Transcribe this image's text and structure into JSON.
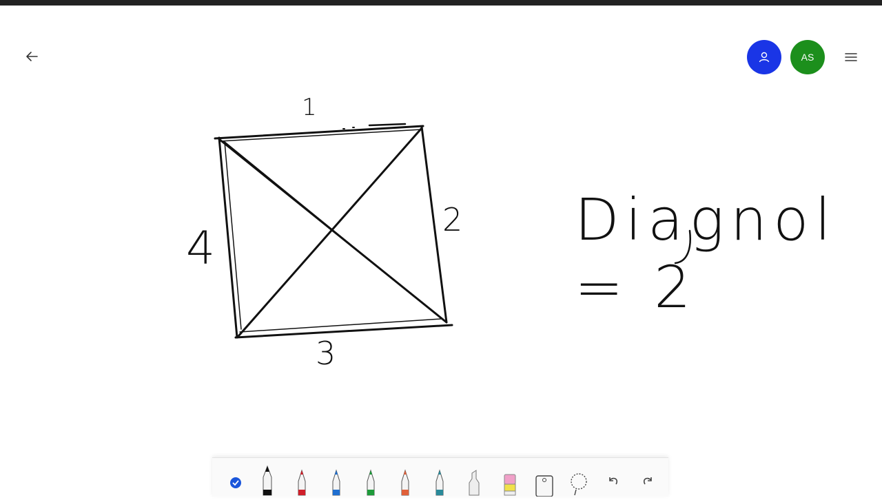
{
  "header": {
    "back_icon": "arrow-left-icon",
    "user_avatar_icon": "person-icon",
    "avatar_initials": "AS",
    "menu_icon": "hamburger-menu-icon",
    "user_avatar_color": "#1a35e6",
    "as_avatar_color": "#1c8f1c"
  },
  "canvas": {
    "side_labels": {
      "top": "1",
      "left": "4",
      "right": "2",
      "bottom": "3"
    },
    "equation": "Diagnol = 2"
  },
  "toolbar": {
    "tools": [
      {
        "name": "select-check",
        "icon": "checkmark-circle-icon",
        "color": "#1a56db",
        "selected": false
      },
      {
        "name": "pen-black",
        "icon": "pen-icon",
        "color": "#111111",
        "selected": true
      },
      {
        "name": "pen-red",
        "icon": "pen-icon",
        "color": "#d01f2a"
      },
      {
        "name": "pen-blue",
        "icon": "pen-icon",
        "color": "#1f6fd0"
      },
      {
        "name": "pen-green",
        "icon": "pen-icon",
        "color": "#1e9a3a"
      },
      {
        "name": "pen-rainbow",
        "icon": "pen-icon",
        "color": "#e0603a"
      },
      {
        "name": "pen-galaxy",
        "icon": "pen-icon",
        "color": "#2a8a9a"
      },
      {
        "name": "highlighter",
        "icon": "highlighter-icon",
        "color": "#b0b0b0"
      },
      {
        "name": "eraser",
        "icon": "eraser-icon",
        "color": "#f0a0c8"
      },
      {
        "name": "ruler",
        "icon": "ruler-icon",
        "color": "#444444"
      },
      {
        "name": "lasso",
        "icon": "lasso-icon",
        "color": "#444444"
      },
      {
        "name": "undo",
        "icon": "undo-icon",
        "color": "#444444"
      },
      {
        "name": "redo",
        "icon": "redo-icon",
        "color": "#444444"
      }
    ]
  }
}
